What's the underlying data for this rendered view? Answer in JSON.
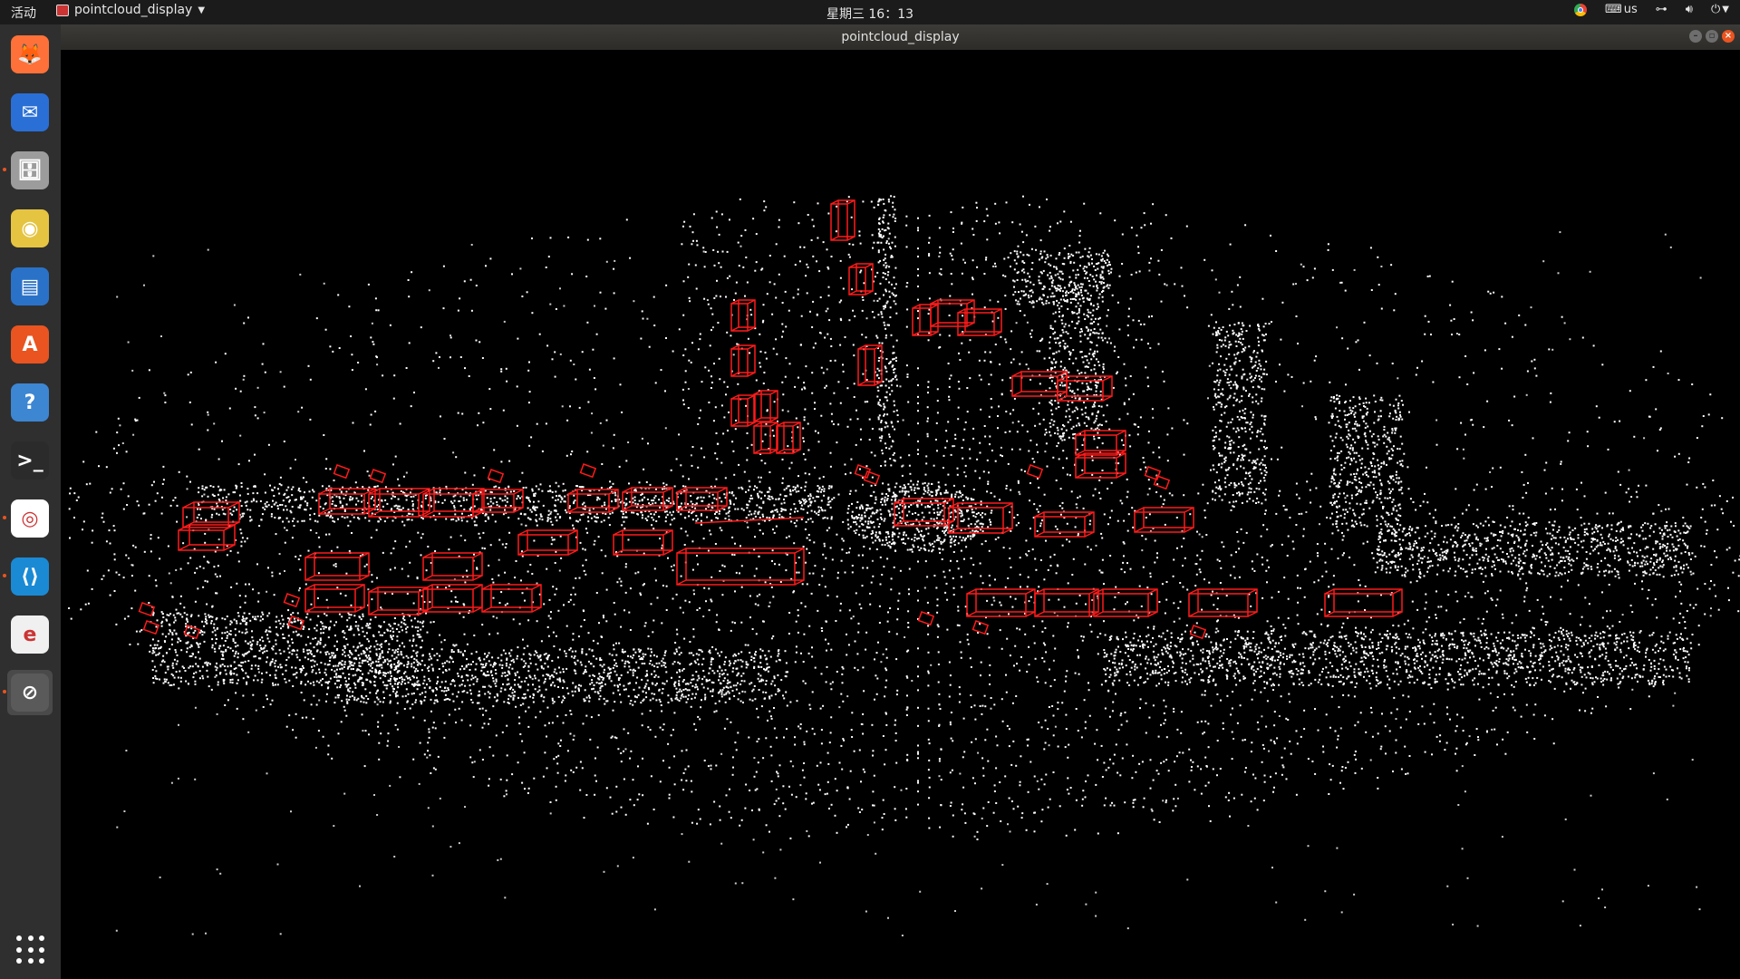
{
  "topbar": {
    "activities": "活动",
    "app_menu_label": "pointcloud_display",
    "clock": "星期三 16：13",
    "keyboard_layout": "us"
  },
  "dock": {
    "items": [
      {
        "name": "firefox",
        "color": "#ff7139",
        "glyph": "🦊",
        "running": false
      },
      {
        "name": "thunderbird",
        "color": "#2a6fd6",
        "glyph": "✉",
        "running": false
      },
      {
        "name": "files",
        "color": "#9c9c9c",
        "glyph": "🗄",
        "running": true
      },
      {
        "name": "rhythmbox",
        "color": "#e5c441",
        "glyph": "◉",
        "running": false
      },
      {
        "name": "libreoffice-writer",
        "color": "#2a72c8",
        "glyph": "▤",
        "running": false
      },
      {
        "name": "software-center",
        "color": "#e95420",
        "glyph": "A",
        "running": false
      },
      {
        "name": "help",
        "color": "#3d86d2",
        "glyph": "?",
        "running": false
      },
      {
        "name": "terminal",
        "color": "#2b2b2b",
        "glyph": ">_",
        "running": false
      },
      {
        "name": "chrome",
        "color": "#ffffff",
        "glyph": "◎",
        "running": true
      },
      {
        "name": "vscode",
        "color": "#1a8ad4",
        "glyph": "⟨⟩",
        "running": true
      },
      {
        "name": "text-editor",
        "color": "#f0f0f0",
        "glyph": "e",
        "running": false
      },
      {
        "name": "pointcloud-app",
        "color": "#5a5a5a",
        "glyph": "⊘",
        "running": true,
        "active": true
      }
    ]
  },
  "window": {
    "title": "pointcloud_display"
  },
  "colors": {
    "box_stroke": "#ff1a1a",
    "points": "#ffffff",
    "background": "#000000"
  }
}
